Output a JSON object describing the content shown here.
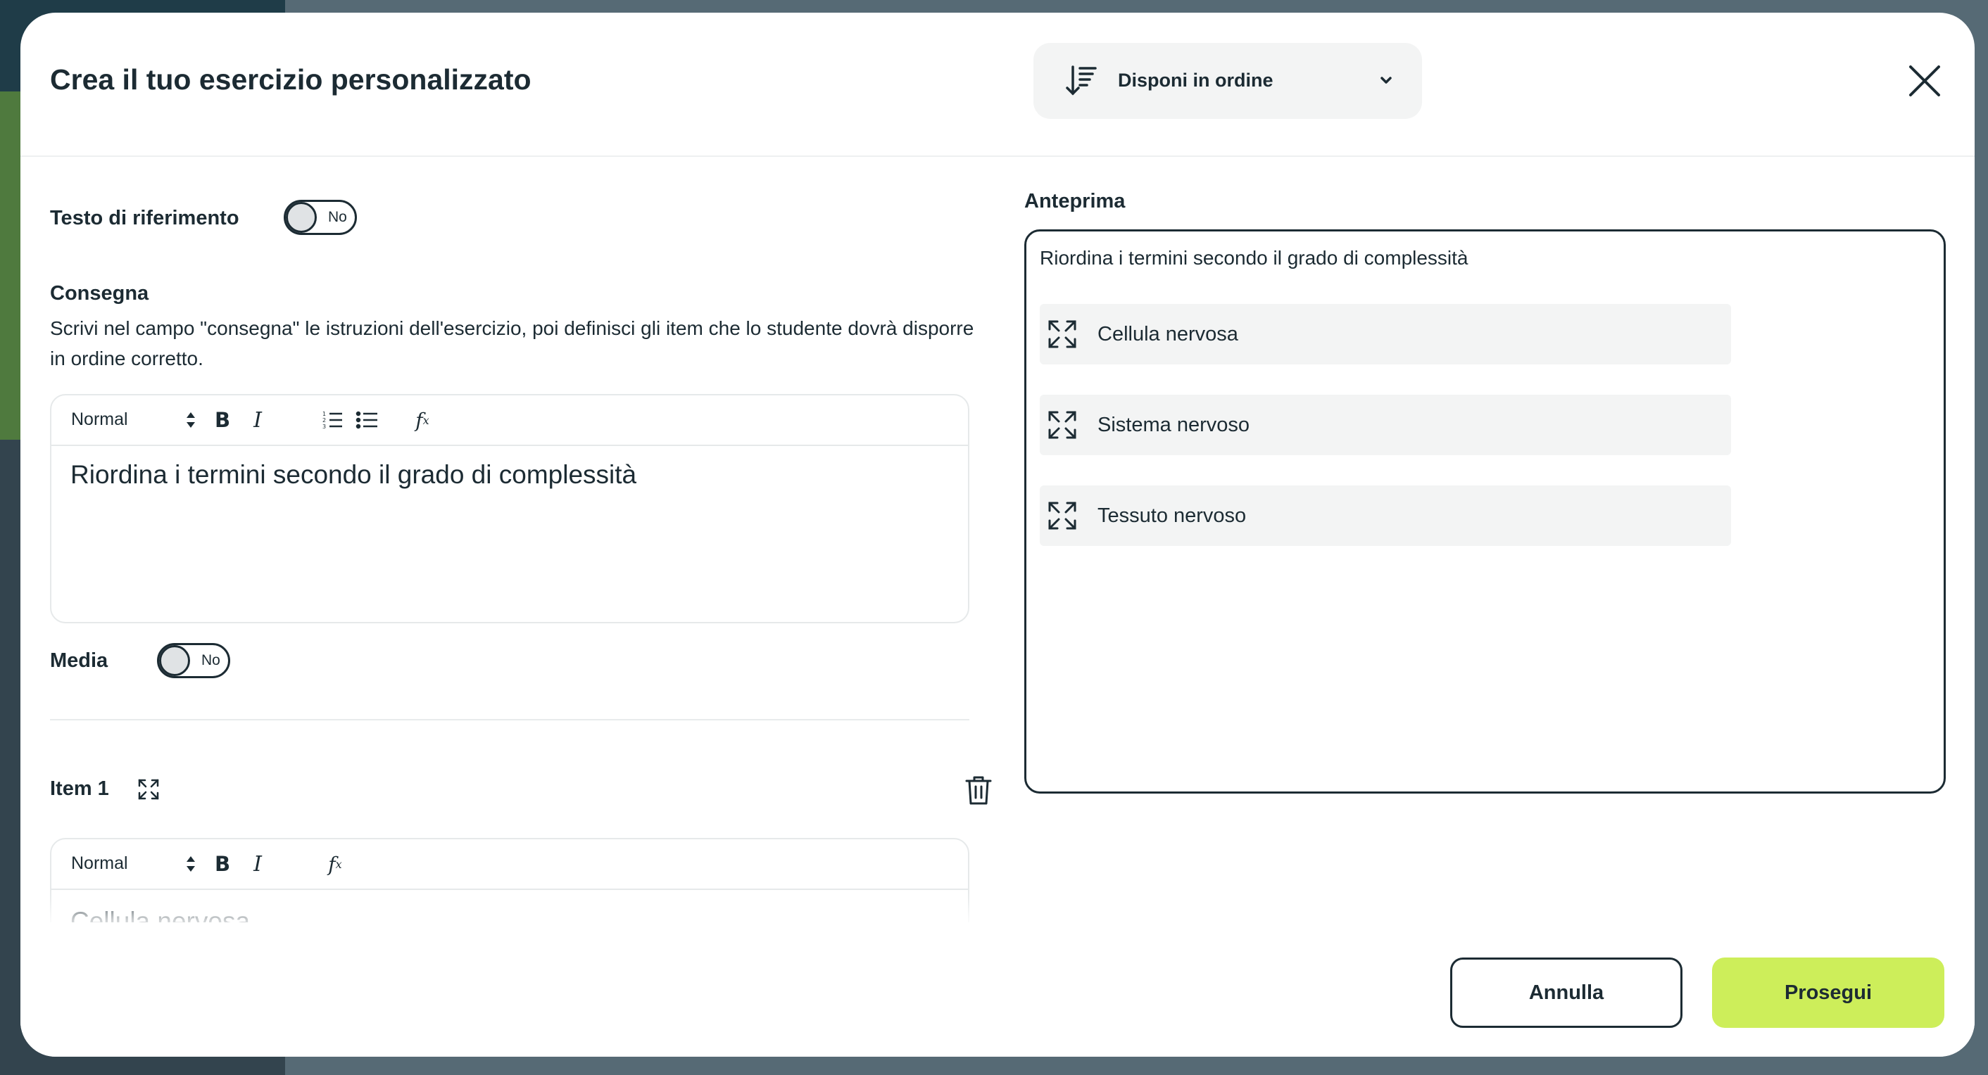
{
  "header": {
    "title": "Crea il tuo esercizio personalizzato",
    "exercise_type": "Disponi in ordine"
  },
  "form": {
    "reference_text": {
      "label": "Testo di riferimento",
      "toggle": "No"
    },
    "instruction": {
      "label": "Consegna",
      "description": "Scrivi nel campo \"consegna\" le istruzioni dell'esercizio, poi definisci gli item che lo studente dovrà disporre in ordine corretto.",
      "format": "Normal",
      "content": "Riordina i termini secondo il grado di complessità"
    },
    "media": {
      "label": "Media",
      "toggle": "No"
    },
    "item1": {
      "label": "Item 1",
      "format": "Normal",
      "content": "Cellula nervosa"
    }
  },
  "preview": {
    "label": "Anteprima",
    "instruction": "Riordina i termini secondo il grado di complessità",
    "items": [
      "Cellula nervosa",
      "Sistema nervoso",
      "Tessuto nervoso"
    ]
  },
  "footer": {
    "cancel_label": "Annulla",
    "next_label": "Prosegui"
  },
  "colors": {
    "primary_text": "#1c2b33",
    "accent": "#cdee5a",
    "item_bg": "#f3f4f4"
  },
  "icons": {
    "sort": "sort-descending-icon",
    "chevron": "chevron-down-icon",
    "close": "close-icon",
    "expand": "expand-arrows-icon",
    "trash": "trash-icon",
    "bold": "bold-icon",
    "italic": "italic-icon",
    "ordered_list": "ordered-list-icon",
    "bullet_list": "bullet-list-icon",
    "formula": "formula-icon"
  }
}
